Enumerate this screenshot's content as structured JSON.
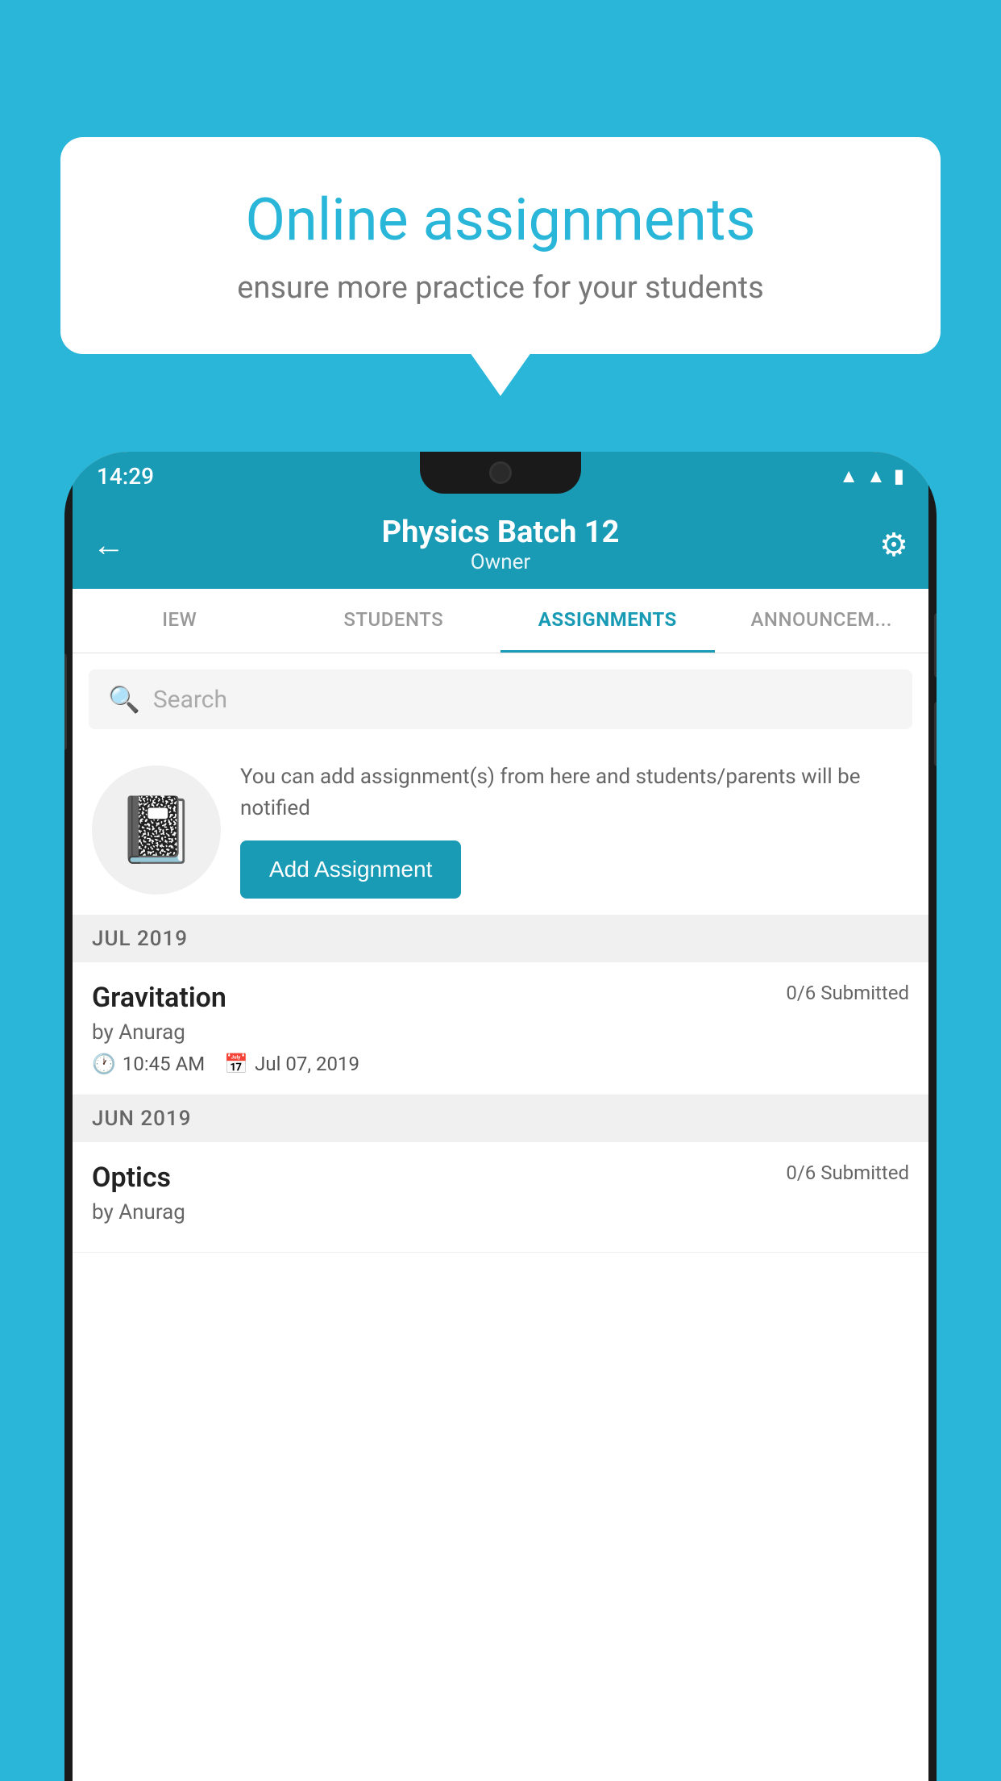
{
  "background": {
    "color": "#29b6d8"
  },
  "speech_bubble": {
    "title": "Online assignments",
    "subtitle": "ensure more practice for your students"
  },
  "status_bar": {
    "time": "14:29",
    "wifi_icon": "▲",
    "signal_icon": "▲",
    "battery_icon": "▮"
  },
  "header": {
    "title": "Physics Batch 12",
    "subtitle": "Owner",
    "back_icon": "←",
    "settings_icon": "⚙"
  },
  "tabs": [
    {
      "label": "IEW",
      "active": false
    },
    {
      "label": "STUDENTS",
      "active": false
    },
    {
      "label": "ASSIGNMENTS",
      "active": true
    },
    {
      "label": "ANNOUNCEM...",
      "active": false
    }
  ],
  "search": {
    "placeholder": "Search"
  },
  "promo": {
    "description": "You can add assignment(s) from here and students/parents will be notified",
    "button_label": "Add Assignment"
  },
  "month_sections": [
    {
      "month": "JUL 2019",
      "assignments": [
        {
          "name": "Gravitation",
          "submitted": "0/6 Submitted",
          "author": "by Anurag",
          "time": "10:45 AM",
          "date": "Jul 07, 2019"
        }
      ]
    },
    {
      "month": "JUN 2019",
      "assignments": [
        {
          "name": "Optics",
          "submitted": "0/6 Submitted",
          "author": "by Anurag",
          "time": "",
          "date": ""
        }
      ]
    }
  ]
}
